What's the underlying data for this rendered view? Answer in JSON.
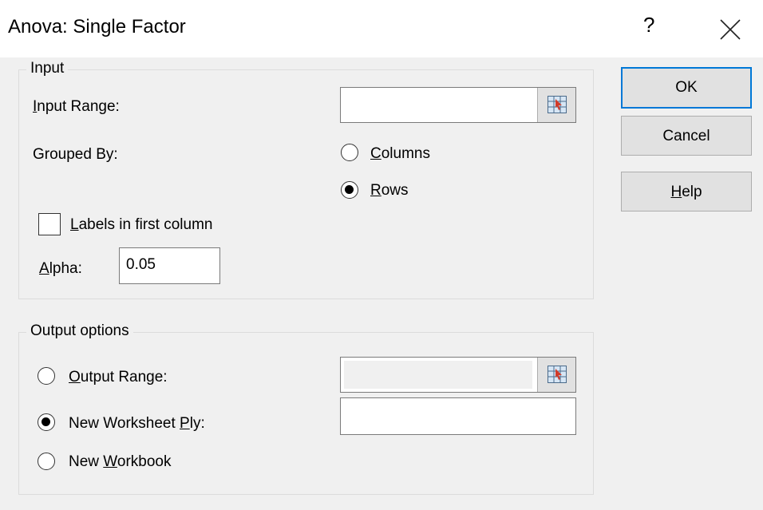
{
  "dialog": {
    "title": "Anova: Single Factor",
    "help_symbol": "?"
  },
  "input_group": {
    "label": "Input",
    "input_range": {
      "label_mnemonic": "I",
      "label_rest": "nput Range:",
      "value": ""
    },
    "grouped_by": {
      "label": "Grouped By:",
      "columns": {
        "mnemonic": "C",
        "rest": "olumns",
        "selected": false
      },
      "rows": {
        "mnemonic": "R",
        "rest": "ows",
        "selected": true
      }
    },
    "labels_checkbox": {
      "mnemonic": "L",
      "rest": "abels in first column",
      "checked": false
    },
    "alpha": {
      "label_mnemonic": "A",
      "label_rest": "lpha:",
      "value": "0.05"
    }
  },
  "output_group": {
    "label": "Output options",
    "output_range": {
      "mnemonic": "O",
      "rest": "utput Range:",
      "selected": false,
      "value": ""
    },
    "new_worksheet": {
      "prefix": "New Worksheet ",
      "mnemonic": "P",
      "rest": "ly:",
      "selected": true,
      "value": ""
    },
    "new_workbook": {
      "prefix": "New ",
      "mnemonic": "W",
      "rest": "orkbook",
      "selected": false
    }
  },
  "buttons": {
    "ok": "OK",
    "cancel": "Cancel",
    "help": {
      "mnemonic": "H",
      "rest": "elp"
    }
  },
  "colors": {
    "focus_border": "#0078d7",
    "dialog_bg": "#f0f0f0"
  }
}
